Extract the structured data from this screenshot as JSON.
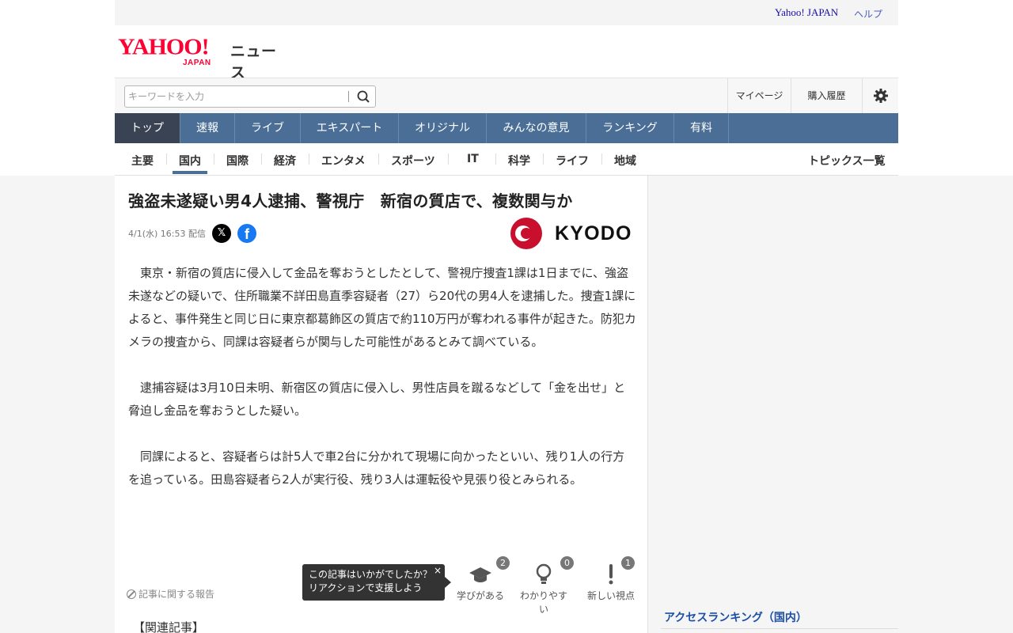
{
  "utility": {
    "yahoo_japan": "Yahoo! JAPAN",
    "help": "ヘルプ"
  },
  "logo": {
    "yahoo": "YAHOO!",
    "japan": "JAPAN",
    "news": "ニュース"
  },
  "search": {
    "placeholder": "キーワードを入力",
    "value": "",
    "icon": "search-icon"
  },
  "header_links": {
    "my_page": "マイページ",
    "purchase_history": "購入履歴",
    "settings_icon": "gear-icon"
  },
  "main_nav": [
    "トップ",
    "速報",
    "ライブ",
    "エキスパート",
    "オリジナル",
    "みんなの意見",
    "ランキング",
    "有料"
  ],
  "main_nav_active": "トップ",
  "sub_nav": [
    "主要",
    "国内",
    "国際",
    "経済",
    "エンタメ",
    "スポーツ",
    "IT",
    "科学",
    "ライフ",
    "地域"
  ],
  "sub_nav_active": "国内",
  "topics_list": "トピックス一覧",
  "article": {
    "headline": "強盗未遂疑い男4人逮捕、警視庁　新宿の質店で、複数関与か",
    "dateline": "4/1(水) 16:53 配信",
    "source": "KYODO",
    "paragraphs": [
      "東京・新宿の質店に侵入して金品を奪おうとしたとして、警視庁捜査1課は1日までに、強盗未遂などの疑いで、住所職業不詳田島直季容疑者（27）ら20代の男4人を逮捕した。捜査1課によると、事件発生と同じ日に東京都葛飾区の質店で約110万円が奪われる事件が起きた。防犯カメラの捜査から、同課は容疑者らが関与した可能性があるとみて調べている。",
      "逮捕容疑は3月10日未明、新宿区の質店に侵入し、男性店員を蹴るなどして「金を出せ」と脅迫し金品を奪おうとした疑い。",
      "同課によると、容疑者らは計5人で車2台に分かれて現場に向かったといい、残り1人の行方を追っている。田島容疑者ら2人が実行役、残り3人は運転役や見張り役とみられる。"
    ],
    "report": "記事に関する報告",
    "tooltip": {
      "line1": "この記事はいかがでしたか？",
      "line2": "リアクションで支援しよう",
      "close": "×"
    },
    "reactions": [
      {
        "label": "学びがある",
        "count": "2",
        "icon": "graduation-cap-icon"
      },
      {
        "label": "わかりやすい",
        "count": "0",
        "icon": "lightbulb-icon"
      },
      {
        "label": "新しい視点",
        "count": "1",
        "icon": "exclamation-icon"
      }
    ],
    "related": "【関連記事】"
  },
  "sidebar": {
    "access_ranking": "アクセスランキング（国内）"
  },
  "colors": {
    "brand_red": "#ff0033",
    "nav_blue": "#4a6e96",
    "nav_active": "#3a4353",
    "link_blue": "#1b4fa5"
  }
}
